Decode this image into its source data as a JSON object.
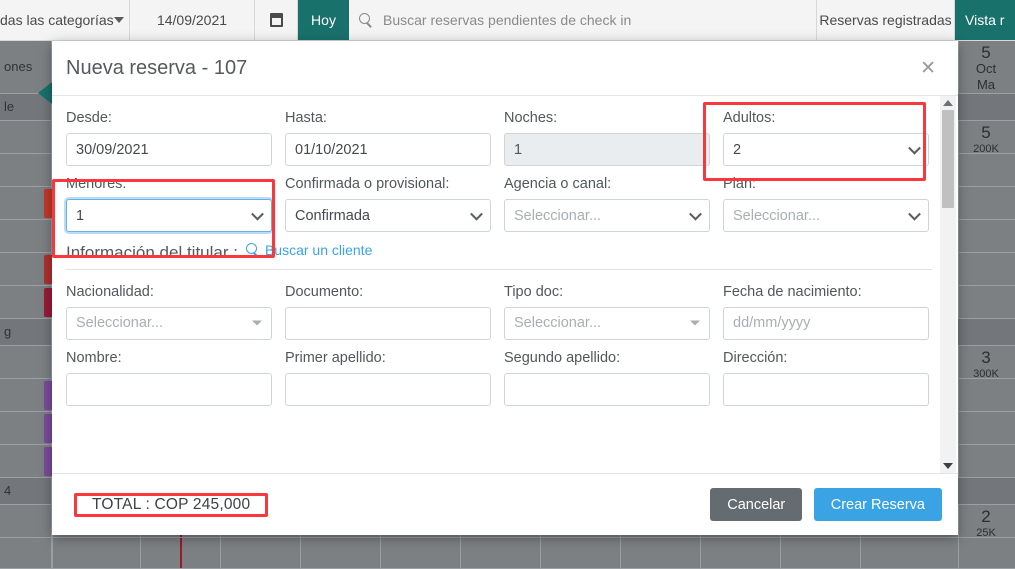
{
  "topbar": {
    "categories_label": "das las categorías",
    "date_value": "14/09/2021",
    "calendar_icon": "calendar-icon",
    "today_label": "Hoy",
    "search_icon": "search-icon",
    "search_placeholder": "Buscar reservas pendientes de check in",
    "registered_label": "Reservas registradas",
    "view_label": "Vista r"
  },
  "calendar_bg": {
    "side_labels": [
      "ones",
      "le",
      "g",
      "4"
    ],
    "columns": [
      {
        "day": "5",
        "month": "Oct",
        "weekday": "Ma"
      }
    ],
    "cells": [
      {
        "count": "5",
        "price": "200K"
      },
      {
        "count": "3",
        "price": "300K"
      },
      {
        "count": "2",
        "price": "25K"
      }
    ]
  },
  "modal": {
    "title": "Nueva reserva - 107",
    "close_icon": "close-icon",
    "fields": {
      "desde": {
        "label": "Desde:",
        "value": "30/09/2021"
      },
      "hasta": {
        "label": "Hasta:",
        "value": "01/10/2021"
      },
      "noches": {
        "label": "Noches:",
        "value": "1"
      },
      "adultos": {
        "label": "Adultos:",
        "value": "2"
      },
      "menores": {
        "label": "Menores:",
        "value": "1"
      },
      "confirmada": {
        "label": "Confirmada o provisional:",
        "value": "Confirmada"
      },
      "agencia": {
        "label": "Agencia o canal:",
        "value": "Seleccionar..."
      },
      "plan": {
        "label": "Plan:",
        "value": "Seleccionar..."
      }
    },
    "section": {
      "title": "Información del titular :",
      "link_label": "Buscar un cliente",
      "link_icon": "search-icon"
    },
    "holder_fields": {
      "nacionalidad": {
        "label": "Nacionalidad:",
        "value": "Seleccionar..."
      },
      "documento": {
        "label": "Documento:",
        "value": ""
      },
      "tipo_doc": {
        "label": "Tipo doc:",
        "value": "Seleccionar..."
      },
      "fecha_nacimiento": {
        "label": "Fecha de nacimiento:",
        "value": "dd/mm/yyyy"
      },
      "nombre": {
        "label": "Nombre:",
        "value": ""
      },
      "primer_apellido": {
        "label": "Primer apellido:",
        "value": ""
      },
      "segundo_apellido": {
        "label": "Segundo apellido:",
        "value": ""
      },
      "direccion": {
        "label": "Dirección:",
        "value": ""
      }
    },
    "footer": {
      "total_label": "TOTAL : COP 245,000",
      "cancel_label": "Cancelar",
      "submit_label": "Crear Reserva"
    }
  },
  "colors": {
    "accent_teal": "#18716b",
    "primary_blue": "#3aa3e3",
    "highlight_red": "#f9383e",
    "cancel_gray": "#646c72"
  }
}
